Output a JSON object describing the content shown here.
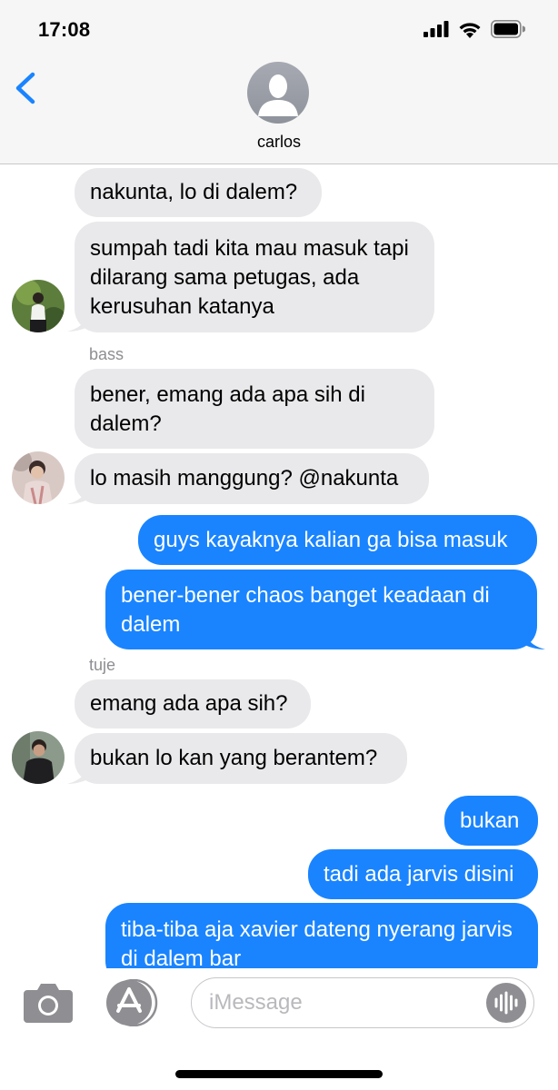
{
  "status_bar": {
    "time": "17:08"
  },
  "header": {
    "contact_name": "carlos"
  },
  "messages": [
    {
      "text": "nakunta, lo di dalem?"
    },
    {
      "text": "sumpah tadi kita mau masuk tapi dilarang sama petugas, ada kerusuhan katanya"
    },
    {
      "sender": "bass"
    },
    {
      "text": "bener, emang ada apa sih di dalem?"
    },
    {
      "text": "lo masih manggung? @nakunta"
    },
    {
      "text": "guys kayaknya kalian ga bisa masuk"
    },
    {
      "text": "bener-bener chaos banget keadaan di dalem"
    },
    {
      "sender": "tuje"
    },
    {
      "text": "emang ada apa sih?"
    },
    {
      "text": "bukan lo kan yang berantem?"
    },
    {
      "text": "bukan"
    },
    {
      "text": "tadi ada jarvis disini"
    },
    {
      "text": "tiba-tiba aja xavier dateng nyerang jarvis di dalem bar"
    }
  ],
  "composer": {
    "placeholder": "iMessage"
  },
  "icons": {
    "back": "chevron-left-icon",
    "camera": "camera-icon",
    "appstore": "app-store-icon",
    "audio": "waveform-icon",
    "signal": "signal-icon",
    "wifi": "wifi-icon",
    "battery": "battery-icon"
  },
  "colors": {
    "accent": "#1a84ff",
    "incoming_bubble": "#e9e9eb"
  }
}
